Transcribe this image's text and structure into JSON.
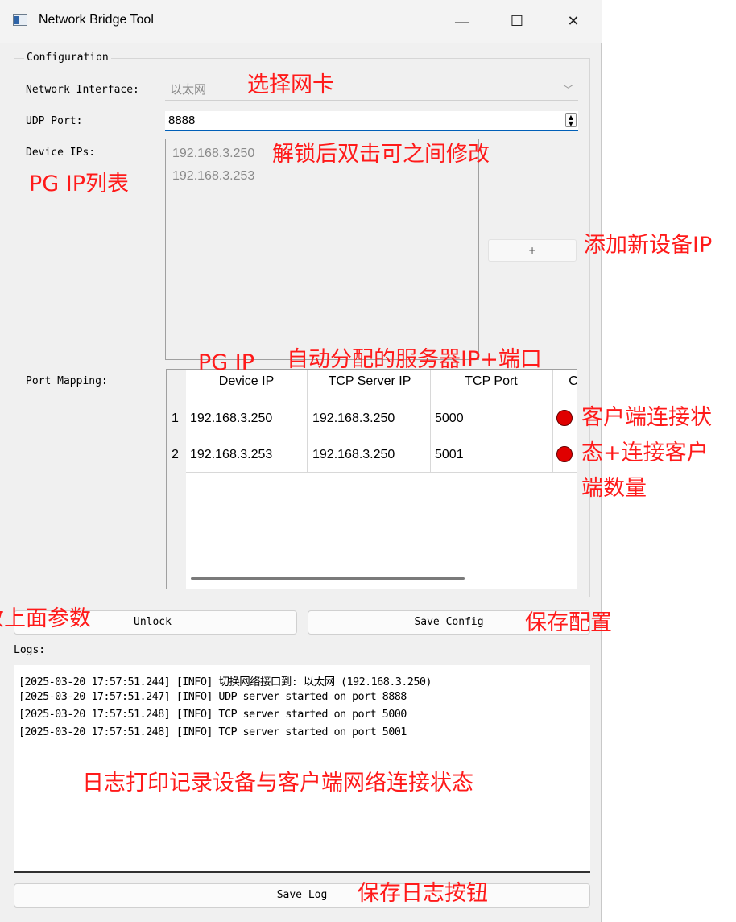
{
  "window": {
    "title": "Network Bridge Tool",
    "minimize": "—",
    "maximize": "☐",
    "close": "✕"
  },
  "config": {
    "group_title": "Configuration",
    "interface_label": "Network Interface:",
    "interface_value": "以太网",
    "udp_label": "UDP Port:",
    "udp_value": "8888",
    "device_ips_label": "Device IPs:",
    "device_ips": [
      "192.168.3.250",
      "192.168.3.253"
    ],
    "add_button": "+",
    "port_mapping_label": "Port Mapping:",
    "table": {
      "headers": [
        "Device IP",
        "TCP Server IP",
        "TCP Port",
        "C"
      ],
      "rows": [
        {
          "num": "1",
          "device_ip": "192.168.3.250",
          "server_ip": "192.168.3.250",
          "port": "5000",
          "status_color": "#e00000"
        },
        {
          "num": "2",
          "device_ip": "192.168.3.253",
          "server_ip": "192.168.3.250",
          "port": "5001",
          "status_color": "#e00000"
        }
      ]
    }
  },
  "buttons": {
    "unlock": "Unlock",
    "save_config": "Save Config",
    "save_log": "Save Log"
  },
  "logs": {
    "label": "Logs:",
    "lines": [
      "[2025-03-20 17:57:51.244] [INFO] 切换网络接口到: 以太网 (192.168.3.250)",
      "[2025-03-20 17:57:51.247] [INFO] UDP server started on port 8888",
      "[2025-03-20 17:57:51.248] [INFO] TCP server started on port 5000",
      "[2025-03-20 17:57:51.248] [INFO] TCP server started on port 5001"
    ]
  },
  "annotations": {
    "select_nic": "选择网卡",
    "unlock_edit": "解锁后双击可之间修改",
    "pg_ip_list": "PG IP列表",
    "add_device": "添加新设备IP",
    "pg_ip": "PG IP",
    "auto_assign": "自动分配的服务器IP+端口",
    "client_status_1": "客户端连接状",
    "client_status_2": "态+连接客户",
    "client_status_3": "端数量",
    "edit_params": "改上面参数",
    "save_config": "保存配置",
    "log_desc": "日志打印记录设备与客户端网络连接状态",
    "save_log": "保存日志按钮"
  },
  "colors": {
    "annotation": "#ff1a1a",
    "status_led": "#e00000",
    "focus": "#005fb8"
  }
}
